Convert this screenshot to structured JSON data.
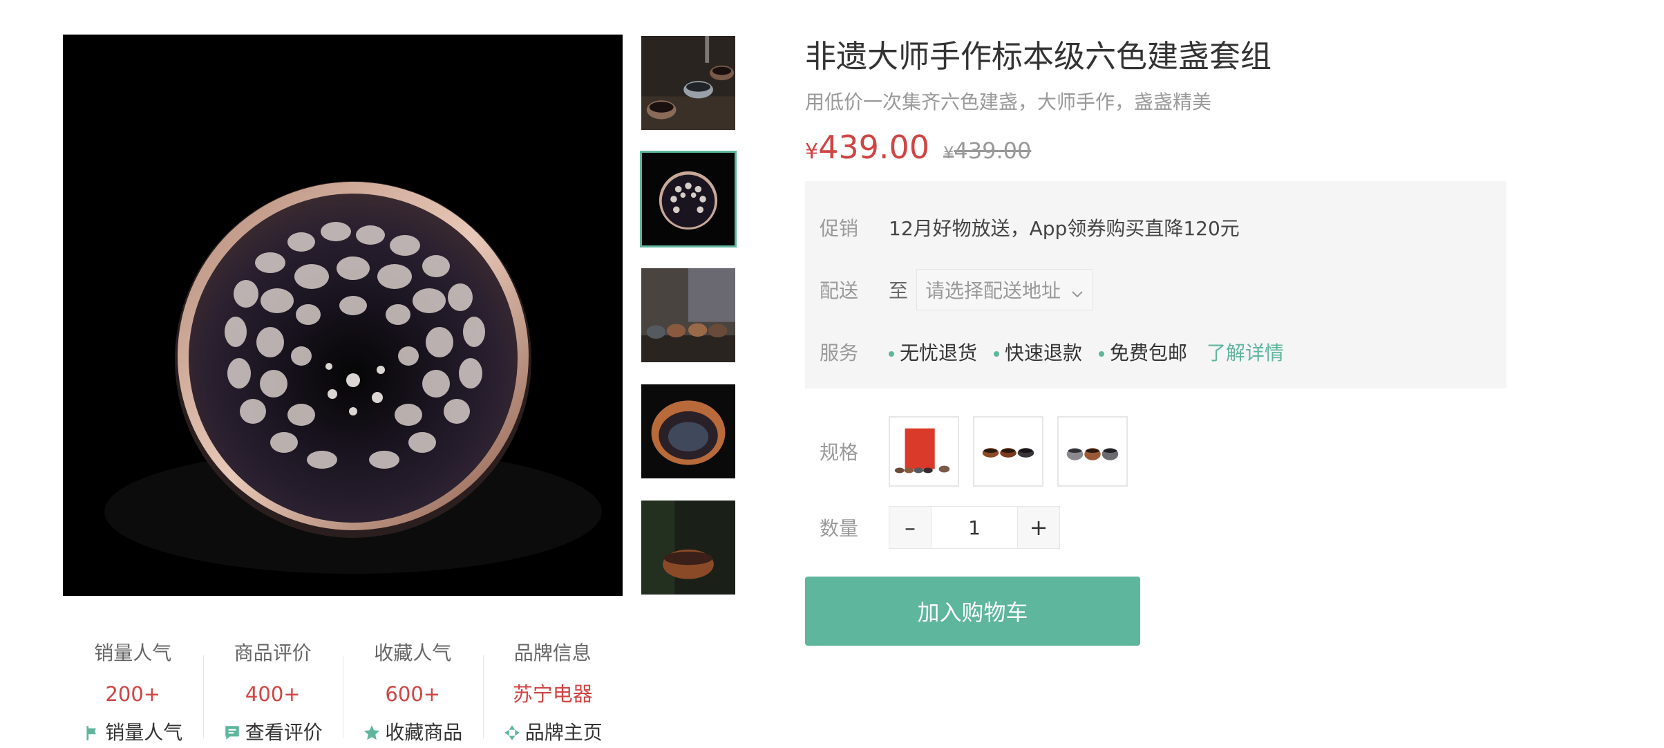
{
  "product": {
    "title": "非遗大师手作标本级六色建盏套组",
    "subtitle": "用低价一次集齐六色建盏，大师手作，盏盏精美",
    "currency": "¥",
    "price": "439.00",
    "original_price": "439.00"
  },
  "panel": {
    "promo_label": "促销",
    "promo_text": "12月好物放送，App领券购买直降120元",
    "delivery_label": "配送",
    "delivery_to": "至",
    "address_placeholder": "请选择配送地址",
    "service_label": "服务",
    "services": [
      "无忧退货",
      "快速退款",
      "免费包邮"
    ],
    "learn_more": "了解详情"
  },
  "spec": {
    "label": "规格"
  },
  "quantity": {
    "label": "数量",
    "minus": "–",
    "plus": "+",
    "value": "1"
  },
  "cart": {
    "label": "加入购物车"
  },
  "stats": [
    {
      "label": "销量人气",
      "value": "200+",
      "link": "销量人气",
      "icon": "flag-icon"
    },
    {
      "label": "商品评价",
      "value": "400+",
      "link": "查看评价",
      "icon": "comment-icon"
    },
    {
      "label": "收藏人气",
      "value": "600+",
      "link": "收藏商品",
      "icon": "star-icon"
    },
    {
      "label": "品牌信息",
      "value": "苏宁电器",
      "link": "品牌主页",
      "icon": "brand-icon"
    }
  ],
  "colors": {
    "accent": "#5eb69c",
    "price": "#cf4444"
  }
}
